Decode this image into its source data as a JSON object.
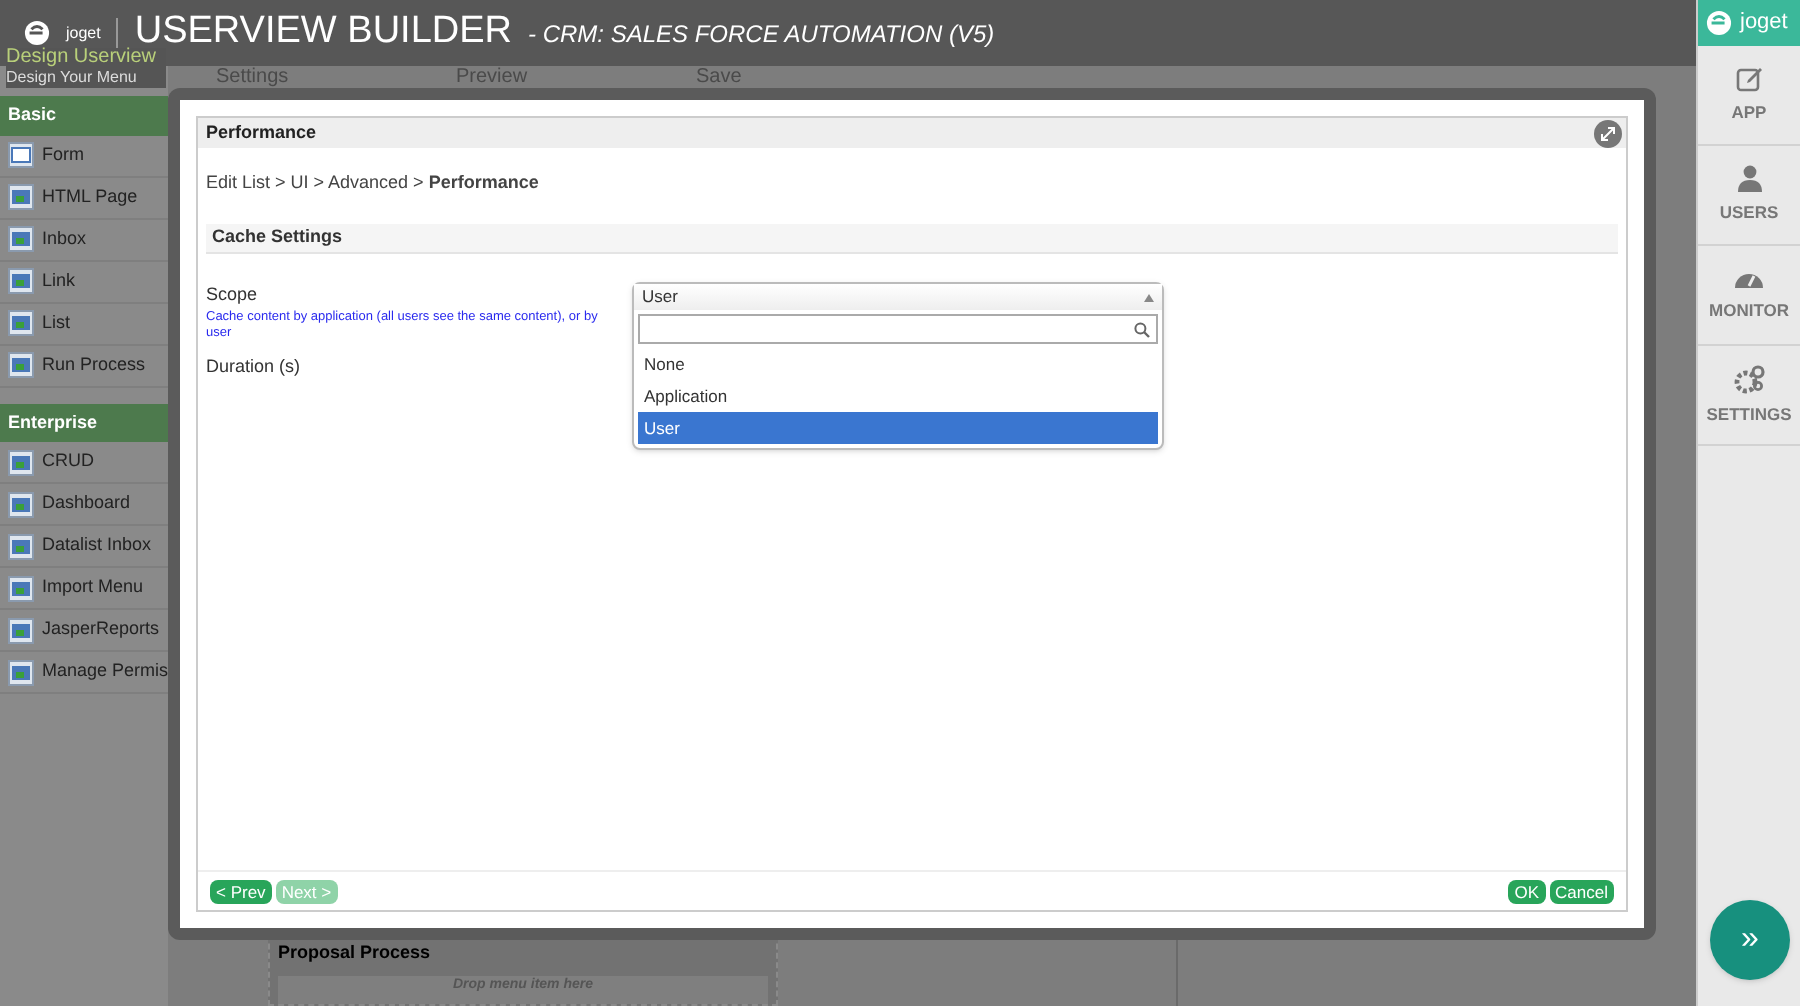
{
  "header": {
    "logo": "joget",
    "title": "USERVIEW BUILDER",
    "subtitle": "- CRM: SALES FORCE AUTOMATION (V5)"
  },
  "builder_tabs": [
    {
      "label": "Design Userview",
      "sublabel": "Design Your Menu",
      "selected": true
    },
    {
      "label": "Settings",
      "selected": false
    },
    {
      "label": "Preview",
      "selected": false
    },
    {
      "label": "Save",
      "selected": false
    }
  ],
  "palette": [
    {
      "title": "Basic",
      "items": [
        "Form",
        "HTML Page",
        "Inbox",
        "Link",
        "List",
        "Run Process"
      ]
    },
    {
      "title": "Enterprise",
      "items": [
        "CRUD",
        "Dashboard",
        "Datalist Inbox",
        "Import Menu",
        "JasperReports",
        "Manage Permis"
      ]
    }
  ],
  "canvas": {
    "category_title": "Proposal Process",
    "drop_hint": "Drop menu item here"
  },
  "right_nav": {
    "logo": "joget",
    "items": [
      {
        "label": "APP",
        "kind": "app"
      },
      {
        "label": "USERS",
        "kind": "users"
      },
      {
        "label": "MONITOR",
        "kind": "monitor"
      },
      {
        "label": "SETTINGS",
        "kind": "settings"
      }
    ],
    "expand_button": "»"
  },
  "dialog": {
    "title": "Performance",
    "breadcrumb": "Edit List > UI > Advanced > **Performance**",
    "section": "Cache Settings",
    "fields": [
      {
        "label": "Scope",
        "description": "Cache content by application (all users see the same content), or by user",
        "kind": "select",
        "value": "User",
        "expanded": true,
        "options": [
          {
            "label": "None",
            "selected": false
          },
          {
            "label": "Application",
            "selected": false
          },
          {
            "label": "User",
            "selected": true
          }
        ]
      },
      {
        "label": "Duration (s)",
        "kind": "text"
      }
    ],
    "nav_buttons": [
      {
        "label": "< Prev",
        "disabled": false
      },
      {
        "label": "Next >",
        "disabled": true
      }
    ],
    "action_buttons": [
      {
        "label": "OK",
        "disabled": false
      },
      {
        "label": "Cancel",
        "disabled": false
      }
    ]
  }
}
